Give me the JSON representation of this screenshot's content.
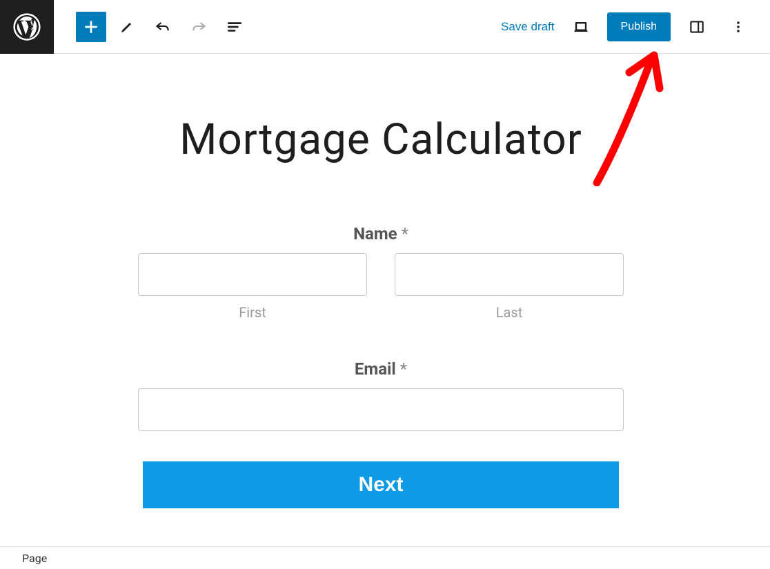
{
  "toolbar": {
    "save_draft_label": "Save draft",
    "publish_label": "Publish"
  },
  "page": {
    "title": "Mortgage Calculator"
  },
  "form": {
    "name_label": "Name",
    "required_marker": "*",
    "first_sublabel": "First",
    "last_sublabel": "Last",
    "email_label": "Email",
    "next_label": "Next"
  },
  "status": {
    "type_label": "Page"
  },
  "colors": {
    "primary": "#007cba",
    "accent": "#0d9be5",
    "annotation": "#ff0000"
  }
}
